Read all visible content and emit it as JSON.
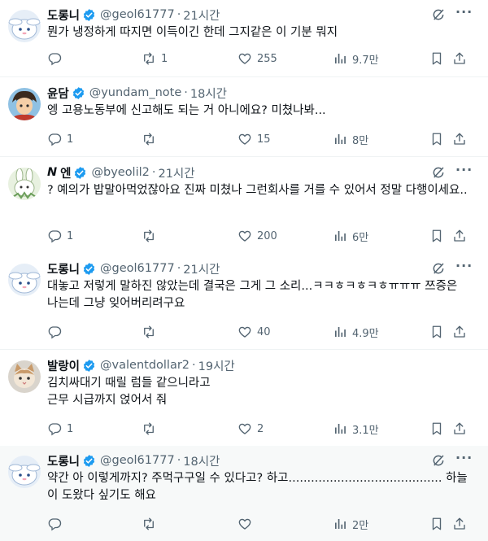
{
  "tweets": [
    {
      "name": "도롱니",
      "handle": "@geol61777",
      "dot": "·",
      "time": "21시간",
      "text": "뭔가 냉정하게 따지면 이득이긴 한데 그지같은 이 기분 뭐지",
      "replies": "",
      "retweets": "1",
      "likes": "255",
      "views": "9.7만",
      "avatar": "cinnamoroll"
    },
    {
      "name": "윤담",
      "handle": "@yundam_note",
      "dot": "·",
      "time": "18시간",
      "text": "엥 고용노동부에 신고해도 되는 거 아니에요? 미쳤나봐...",
      "replies": "1",
      "retweets": "",
      "likes": "15",
      "views": "8만",
      "avatar": "anime-boy"
    },
    {
      "name_prefix": "𝙉",
      "name": "엔",
      "handle": "@byeolil2",
      "dot": "·",
      "time": "21시간",
      "text": "? 예의가 밥말아먹었잖아요 진짜 미쳤나 그런회사를 거를 수 있어서 정말 다행이세요..",
      "replies": "1",
      "retweets": "",
      "likes": "200",
      "views": "6만",
      "avatar": "rabbit"
    },
    {
      "name": "도롱니",
      "handle": "@geol61777",
      "dot": "·",
      "time": "21시간",
      "text": "대놓고 저렇게 말하진 않았는데 결국은 그게 그 소리...ㅋㅋㅎㅋㅎㅋㅎㅠㅠㅠ 쯔증은 나는데 그냥 잊어버리려구요",
      "replies": "",
      "retweets": "",
      "likes": "40",
      "views": "4.9만",
      "avatar": "cinnamoroll"
    },
    {
      "name": "발랑이",
      "handle": "@valentdollar2",
      "dot": "·",
      "time": "19시간",
      "text": "김치싸대기 때릴 럼들 같으니라고\n근무 시급까지 얹어서 줘",
      "replies": "1",
      "retweets": "",
      "likes": "2",
      "views": "3.1만",
      "avatar": "cat"
    },
    {
      "name": "도롱니",
      "handle": "@geol61777",
      "dot": "·",
      "time": "18시간",
      "text": "약간 아 이렇게까지? 주먹구구일 수 있다고? 하고......................................... 하늘이 도왔다 싶기도 해요",
      "replies": "",
      "retweets": "",
      "likes": "",
      "views": "2만",
      "avatar": "cinnamoroll"
    }
  ],
  "colors": {
    "verified": "#1d9bf0",
    "text": "#0f1419",
    "secondary": "#536471",
    "divider": "#eff3f4",
    "thread": "#cfd9de",
    "highlight_bg": "#f7f9f9"
  },
  "icons": [
    "reply-icon",
    "retweet-icon",
    "like-icon",
    "views-icon",
    "bookmark-icon",
    "share-icon",
    "grok-icon",
    "more-icon",
    "verified-badge-icon"
  ]
}
